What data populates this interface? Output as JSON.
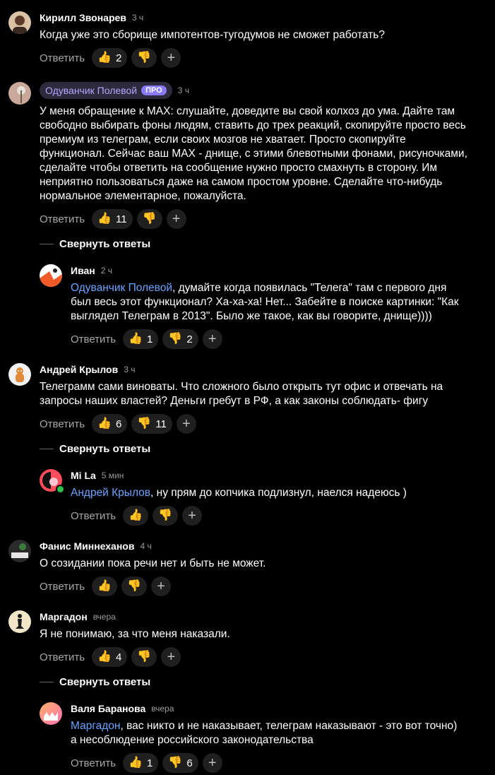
{
  "ui": {
    "reply_label": "Ответить",
    "collapse_label": "Свернуть ответы",
    "add_reaction_symbol": "+",
    "pro_badge": "ПРО",
    "colors": {
      "background": "#000000",
      "mention": "#6aa3ff",
      "pro_badge": "#8a79ff",
      "online": "#2fbf4a"
    }
  },
  "comments": [
    {
      "author": "Кирилл Звонарев",
      "time": "3 ч",
      "text": "Когда уже это сборище импотентов-тугодумов не сможет работать?",
      "likes": "2",
      "dislikes": ""
    },
    {
      "author": "Одуванчик Полевой",
      "time": "3 ч",
      "pro": true,
      "text": "У меня обращение к MAX: слушайте, доведите вы свой колхоз до ума. Дайте там\nсвободно выбирать фоны людям, ставить до трех реакций, скопируйте просто весь\nпремиум из телеграм, если своих мозгов не хватает. Просто скопируйте\nфункционал. Сейчас ваш MAX - днище, с этими блевотными фонами, рисуночками,\nсделайте чтобы ответить на сообщение нужно просто смахнуть в сторону. Им\nнеприятно пользоваться даже на самом простом уровне. Сделайте что-нибудь\nнормальное элементарное, пожалуйста.",
      "likes": "11",
      "dislikes": ""
    },
    {
      "author": "Иван",
      "time": "2 ч",
      "mention": "Одуванчик Полевой",
      "text": ", думайте когда появилась \"Телега\" там с первого дня\nбыл весь этот функционал? Ха-ха-ха! Нет... Забейте в поиске картинки: \"Как\nвыглядел Телеграм в 2013\". Было же такое, как вы говорите, днище))))",
      "likes": "1",
      "dislikes": "2"
    },
    {
      "author": "Андрей Крылов",
      "time": "3 ч",
      "text": "Телеграмм сами виноваты. Что сложного было открыть тут офис и отвечать на\nзапросы наших властей? Деньги гребут в РФ, а как законы соблюдать- фигу",
      "likes": "6",
      "dislikes": "11"
    },
    {
      "author": "Mi La",
      "time": "5 мин",
      "mention": "Андрей Крылов",
      "text": ", ну прям до копчика подлизнул, наелся надеюсь )",
      "likes": "",
      "dislikes": ""
    },
    {
      "author": "Фанис Миннеханов",
      "time": "4 ч",
      "text": "О созидании пока речи нет и быть не может.",
      "likes": "",
      "dislikes": ""
    },
    {
      "author": "Маргадон",
      "time": "вчера",
      "text": "Я не понимаю, за что меня наказали.",
      "likes": "4",
      "dislikes": ""
    },
    {
      "author": "Валя Баранова",
      "time": "вчера",
      "mention": "Маргадон",
      "text": ", вас никто и не наказывает, телеграм наказывают - это вот точно)\nа несоблюдение российского законодательства",
      "likes": "1",
      "dislikes": "6"
    }
  ]
}
